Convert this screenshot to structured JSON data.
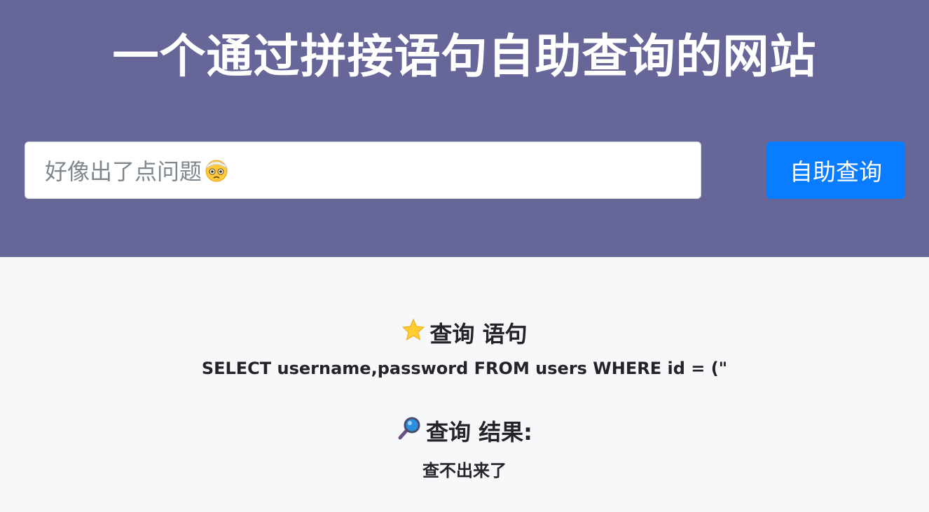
{
  "header": {
    "title": "一个通过拼接语句自助查询的网站"
  },
  "search": {
    "placeholder": "好像出了点问题",
    "placeholder_icon": "face-with-head-bandage-icon",
    "button_label": "自助查询"
  },
  "statement_section": {
    "icon": "star-icon",
    "heading": "查询 语句",
    "text": "SELECT username,password FROM users WHERE id = (\""
  },
  "result_section": {
    "icon": "magnifier-icon",
    "heading": "查询 结果:",
    "text": "查不出来了"
  },
  "colors": {
    "header_bg": "#676698",
    "button_bg": "#0a7cff",
    "page_bg": "#f7f8fa",
    "text": "#222428"
  }
}
